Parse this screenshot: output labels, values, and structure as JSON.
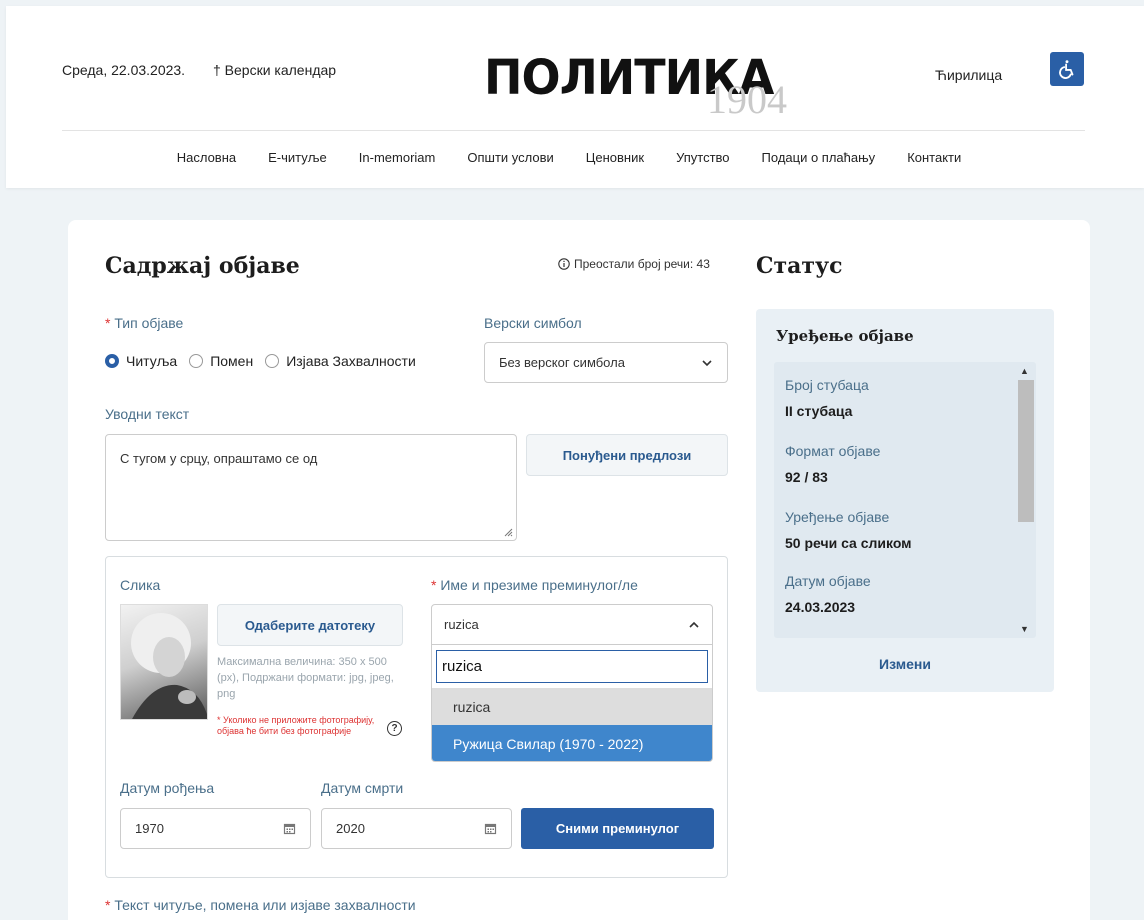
{
  "header": {
    "date": "Среда, 22.03.2023.",
    "calendar": "† Верски календар",
    "logo": "ПОЛИТИКА",
    "logo_year": "1904",
    "language": "Ћирилица",
    "accessibility_icon": "wheelchair-icon"
  },
  "nav": [
    "Насловна",
    "Е-читуље",
    "In-memoriam",
    "Општи услови",
    "Ценовник",
    "Упутство",
    "Подаци о плаћању",
    "Контакти"
  ],
  "content": {
    "title": "Садржај објаве",
    "words_left": "Преостали број речи: 43",
    "type_label": "Тип објаве",
    "type_options": [
      "Читуља",
      "Помен",
      "Изјава Захвалности"
    ],
    "type_selected": 0,
    "symbol_label": "Верски симбол",
    "symbol_value": "Без верског симбола",
    "intro_label": "Уводни текст",
    "intro_value": "С тугом у срцу, опраштамо се од",
    "suggest_button": "Понуђени предлози",
    "image_label": "Слика",
    "file_button": "Одаберите датотеку",
    "max_size": "Максимална величина: 350 x 500 (px), Подржани формати: jpg, jpeg, png",
    "no_photo_note": "* Уколико не приложите фотографију, објава ће бити без фотографије",
    "help_icon": "?",
    "name_label": "Име и презиме преминулог/ле",
    "name_value": "ruzica",
    "search_value": "ruzica",
    "options": [
      "ruzica",
      "Ружица Свилар (1970 - 2022)"
    ],
    "birth_label": "Датум рођења",
    "birth_value": "1970",
    "death_label": "Датум смрти",
    "death_value": "2020",
    "save_button": "Сними преминулог",
    "text_label": "Текст читуље, помена или изјаве захвалности"
  },
  "status": {
    "title": "Статус",
    "panel_title": "Уређење објаве",
    "items": [
      {
        "label": "Број стубаца",
        "value": "II стубаца"
      },
      {
        "label": "Формат објаве",
        "value": "92 / 83"
      },
      {
        "label": "Уређење објаве",
        "value": "50 речи са сликом"
      },
      {
        "label": "Датум објаве",
        "value": "24.03.2023"
      }
    ],
    "change_link": "Измени"
  }
}
